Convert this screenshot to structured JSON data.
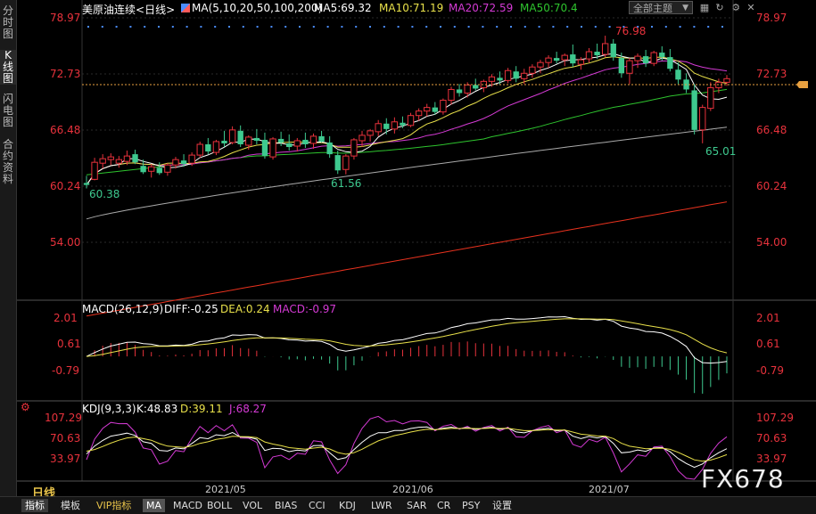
{
  "sidebar": {
    "tabs": [
      {
        "label": "分时图"
      },
      {
        "label": "K线图"
      },
      {
        "label": "闪电图"
      },
      {
        "label": "合约资料"
      }
    ]
  },
  "header": {
    "symbol": "美原油连续",
    "period": "<日线>",
    "ma_label": "MA(5,10,20,50,100,200)",
    "ma5": "MA5:69.32",
    "ma10": "MA10:71.19",
    "ma20": "MA20:72.59",
    "ma50": "MA50:70.4",
    "theme_select": "全部主题"
  },
  "price_axis": {
    "ticks": [
      "78.97",
      "72.73",
      "66.48",
      "60.24",
      "54.00"
    ]
  },
  "annotations": {
    "high": "76.98",
    "low1": "60.38",
    "low2": "61.56",
    "low3": "65.01"
  },
  "macd": {
    "title": "MACD(26,12,9)",
    "diff": "DIFF:-0.25",
    "dea": "DEA:0.24",
    "macd": "MACD:-0.97",
    "ticks": [
      "2.01",
      "0.61",
      "-0.79"
    ]
  },
  "kdj": {
    "title": "KDJ(9,3,3)",
    "k": "K:48.83",
    "d": "D:39.11",
    "j": "J:68.27",
    "ticks": [
      "107.29",
      "70.63",
      "33.97"
    ]
  },
  "dates": [
    "2021/05",
    "2021/06",
    "2021/07"
  ],
  "period_label": "日线",
  "bottom_tabs": [
    "指标",
    "模板",
    "VIP指标",
    "MA",
    "MACD",
    "BOLL",
    "VOL",
    "BIAS",
    "CCI",
    "KDJ",
    "LWR",
    "SAR",
    "CR",
    "PSY",
    "设置"
  ],
  "watermark": "FX678",
  "colors": {
    "up": "#e8323c",
    "down": "#3ec98f",
    "ma5": "#ffffff",
    "ma10": "#e8e04a",
    "ma20": "#d43ad4",
    "ma50": "#2ec42e",
    "ma100": "#aaaaaa",
    "ma200": "#e8321e"
  },
  "chart_data": {
    "type": "candlestick",
    "ylim": [
      54.0,
      78.97
    ],
    "candles": [
      {
        "o": 60.6,
        "h": 61.4,
        "l": 60.0,
        "c": 60.38
      },
      {
        "o": 61.0,
        "h": 63.4,
        "l": 60.9,
        "c": 62.9
      },
      {
        "o": 62.8,
        "h": 63.8,
        "l": 62.2,
        "c": 63.3
      },
      {
        "o": 63.2,
        "h": 63.9,
        "l": 62.6,
        "c": 63.5
      },
      {
        "o": 62.8,
        "h": 63.6,
        "l": 62.3,
        "c": 63.2
      },
      {
        "o": 63.0,
        "h": 64.2,
        "l": 62.6,
        "c": 63.6
      },
      {
        "o": 63.8,
        "h": 64.3,
        "l": 62.7,
        "c": 62.9
      },
      {
        "o": 62.5,
        "h": 63.2,
        "l": 61.6,
        "c": 61.8
      },
      {
        "o": 61.9,
        "h": 62.7,
        "l": 61.2,
        "c": 62.4
      },
      {
        "o": 62.3,
        "h": 62.9,
        "l": 61.5,
        "c": 61.7
      },
      {
        "o": 61.8,
        "h": 62.8,
        "l": 61.4,
        "c": 62.6
      },
      {
        "o": 62.6,
        "h": 63.5,
        "l": 62.2,
        "c": 63.2
      },
      {
        "o": 63.1,
        "h": 63.8,
        "l": 62.4,
        "c": 62.7
      },
      {
        "o": 62.8,
        "h": 64.0,
        "l": 62.5,
        "c": 63.7
      },
      {
        "o": 63.7,
        "h": 65.2,
        "l": 63.4,
        "c": 64.9
      },
      {
        "o": 64.9,
        "h": 65.6,
        "l": 63.8,
        "c": 64.1
      },
      {
        "o": 64.0,
        "h": 65.4,
        "l": 63.7,
        "c": 65.2
      },
      {
        "o": 65.3,
        "h": 66.4,
        "l": 64.6,
        "c": 65.0
      },
      {
        "o": 65.1,
        "h": 66.9,
        "l": 64.9,
        "c": 66.5
      },
      {
        "o": 66.4,
        "h": 67.0,
        "l": 64.6,
        "c": 64.9
      },
      {
        "o": 64.8,
        "h": 65.9,
        "l": 64.3,
        "c": 65.7
      },
      {
        "o": 65.6,
        "h": 66.6,
        "l": 64.9,
        "c": 65.3
      },
      {
        "o": 65.4,
        "h": 66.2,
        "l": 63.3,
        "c": 63.6
      },
      {
        "o": 63.5,
        "h": 65.7,
        "l": 63.2,
        "c": 65.5
      },
      {
        "o": 65.5,
        "h": 66.3,
        "l": 64.7,
        "c": 65.1
      },
      {
        "o": 65.0,
        "h": 66.0,
        "l": 64.2,
        "c": 64.6
      },
      {
        "o": 64.7,
        "h": 65.6,
        "l": 64.1,
        "c": 65.3
      },
      {
        "o": 65.4,
        "h": 66.2,
        "l": 64.5,
        "c": 64.9
      },
      {
        "o": 65.0,
        "h": 66.1,
        "l": 64.4,
        "c": 65.8
      },
      {
        "o": 65.8,
        "h": 66.4,
        "l": 65.1,
        "c": 65.2
      },
      {
        "o": 65.1,
        "h": 65.8,
        "l": 63.4,
        "c": 63.8
      },
      {
        "o": 63.7,
        "h": 64.2,
        "l": 61.6,
        "c": 62.0
      },
      {
        "o": 62.1,
        "h": 63.8,
        "l": 61.56,
        "c": 63.6
      },
      {
        "o": 63.6,
        "h": 65.6,
        "l": 63.2,
        "c": 65.4
      },
      {
        "o": 65.3,
        "h": 66.4,
        "l": 64.6,
        "c": 65.9
      },
      {
        "o": 65.9,
        "h": 66.6,
        "l": 65.2,
        "c": 66.4
      },
      {
        "o": 66.3,
        "h": 67.6,
        "l": 65.8,
        "c": 67.2
      },
      {
        "o": 67.2,
        "h": 67.8,
        "l": 66.0,
        "c": 66.6
      },
      {
        "o": 66.6,
        "h": 67.9,
        "l": 66.1,
        "c": 67.4
      },
      {
        "o": 67.3,
        "h": 68.0,
        "l": 66.7,
        "c": 67.0
      },
      {
        "o": 67.0,
        "h": 68.4,
        "l": 66.8,
        "c": 68.1
      },
      {
        "o": 68.1,
        "h": 68.9,
        "l": 67.5,
        "c": 68.6
      },
      {
        "o": 68.6,
        "h": 69.4,
        "l": 68.0,
        "c": 69.0
      },
      {
        "o": 69.0,
        "h": 69.6,
        "l": 68.2,
        "c": 68.5
      },
      {
        "o": 68.5,
        "h": 70.0,
        "l": 68.2,
        "c": 69.8
      },
      {
        "o": 69.8,
        "h": 71.3,
        "l": 69.3,
        "c": 71.0
      },
      {
        "o": 71.0,
        "h": 71.6,
        "l": 70.2,
        "c": 70.6
      },
      {
        "o": 70.6,
        "h": 71.8,
        "l": 70.1,
        "c": 71.5
      },
      {
        "o": 71.5,
        "h": 72.2,
        "l": 70.9,
        "c": 71.1
      },
      {
        "o": 71.2,
        "h": 72.1,
        "l": 70.7,
        "c": 71.9
      },
      {
        "o": 71.9,
        "h": 72.7,
        "l": 71.3,
        "c": 72.4
      },
      {
        "o": 72.3,
        "h": 73.0,
        "l": 71.6,
        "c": 72.0
      },
      {
        "o": 72.0,
        "h": 73.4,
        "l": 71.7,
        "c": 73.1
      },
      {
        "o": 73.0,
        "h": 73.6,
        "l": 71.8,
        "c": 72.2
      },
      {
        "o": 72.2,
        "h": 73.3,
        "l": 71.6,
        "c": 72.8
      },
      {
        "o": 72.8,
        "h": 73.8,
        "l": 72.3,
        "c": 73.5
      },
      {
        "o": 73.5,
        "h": 74.3,
        "l": 72.8,
        "c": 74.0
      },
      {
        "o": 74.0,
        "h": 74.8,
        "l": 73.4,
        "c": 74.5
      },
      {
        "o": 74.5,
        "h": 75.2,
        "l": 73.9,
        "c": 74.2
      },
      {
        "o": 74.3,
        "h": 75.0,
        "l": 73.6,
        "c": 74.8
      },
      {
        "o": 74.9,
        "h": 76.0,
        "l": 73.5,
        "c": 73.9
      },
      {
        "o": 73.8,
        "h": 74.6,
        "l": 73.2,
        "c": 74.3
      },
      {
        "o": 74.4,
        "h": 75.6,
        "l": 74.0,
        "c": 75.2
      },
      {
        "o": 75.2,
        "h": 76.1,
        "l": 74.4,
        "c": 74.8
      },
      {
        "o": 74.9,
        "h": 76.98,
        "l": 74.6,
        "c": 76.1
      },
      {
        "o": 76.1,
        "h": 76.6,
        "l": 74.2,
        "c": 74.6
      },
      {
        "o": 74.5,
        "h": 75.1,
        "l": 72.3,
        "c": 72.8
      },
      {
        "o": 72.8,
        "h": 74.5,
        "l": 71.6,
        "c": 74.2
      },
      {
        "o": 74.2,
        "h": 75.0,
        "l": 73.4,
        "c": 74.7
      },
      {
        "o": 74.7,
        "h": 75.4,
        "l": 73.5,
        "c": 73.9
      },
      {
        "o": 73.9,
        "h": 75.3,
        "l": 73.6,
        "c": 75.1
      },
      {
        "o": 75.1,
        "h": 75.8,
        "l": 74.2,
        "c": 74.6
      },
      {
        "o": 74.6,
        "h": 75.5,
        "l": 73.0,
        "c": 73.3
      },
      {
        "o": 73.2,
        "h": 74.0,
        "l": 71.6,
        "c": 72.1
      },
      {
        "o": 72.1,
        "h": 72.8,
        "l": 70.6,
        "c": 71.0
      },
      {
        "o": 70.9,
        "h": 71.6,
        "l": 66.0,
        "c": 66.5
      },
      {
        "o": 66.5,
        "h": 69.3,
        "l": 65.01,
        "c": 69.0
      },
      {
        "o": 68.9,
        "h": 71.8,
        "l": 68.6,
        "c": 71.2
      },
      {
        "o": 71.2,
        "h": 72.2,
        "l": 70.6,
        "c": 71.8
      },
      {
        "o": 71.8,
        "h": 72.6,
        "l": 71.4,
        "c": 72.2
      }
    ]
  }
}
